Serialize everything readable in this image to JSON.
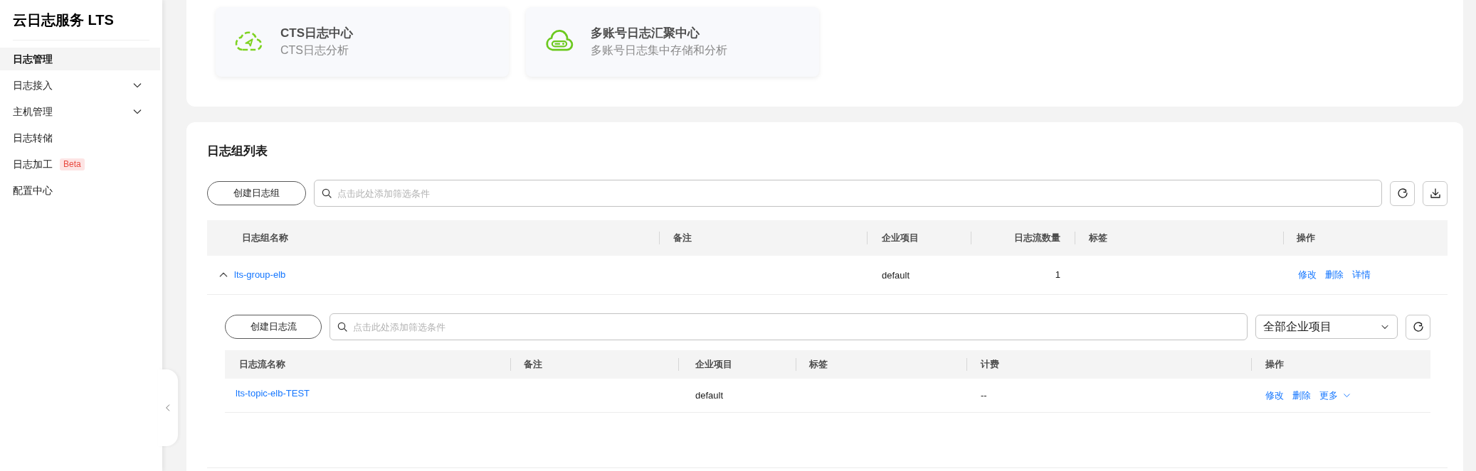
{
  "sidebar": {
    "title": "云日志服务 LTS",
    "items": [
      {
        "label": "日志管理",
        "selected": true,
        "kind": "link"
      },
      {
        "label": "日志接入",
        "selected": false,
        "kind": "group"
      },
      {
        "label": "主机管理",
        "selected": false,
        "kind": "group"
      },
      {
        "label": "日志转储",
        "selected": false,
        "kind": "link"
      },
      {
        "label": "日志加工",
        "selected": false,
        "kind": "link",
        "badge": "Beta"
      },
      {
        "label": "配置中心",
        "selected": false,
        "kind": "link"
      }
    ]
  },
  "cards": [
    {
      "title": "CTS日志中心",
      "subtitle": "CTS日志分析"
    },
    {
      "title": "多账号日志汇聚中心",
      "subtitle": "多账号日志集中存储和分析"
    }
  ],
  "log_groups": {
    "title": "日志组列表",
    "create_button": "创建日志组",
    "search": {
      "placeholder": "点击此处添加筛选条件"
    },
    "columns": [
      "日志组名称",
      "备注",
      "企业项目",
      "日志流数量",
      "标签",
      "操作"
    ],
    "rows": [
      {
        "expanded": true,
        "name": "lts-group-elb",
        "enterprise_project": "default",
        "stream_count": "1",
        "actions": [
          {
            "label": "修改",
            "kind": "link"
          },
          {
            "label": "删除",
            "kind": "link"
          },
          {
            "label": "详情",
            "kind": "link"
          }
        ],
        "streams": {
          "create_button": "创建日志流",
          "search": {
            "placeholder": "点击此处添加筛选条件"
          },
          "project_select": "全部企业项目",
          "columns": [
            "日志流名称",
            "备注",
            "企业项目",
            "标签",
            "计费",
            "操作"
          ],
          "rows": [
            {
              "name": "lts-topic-elb-TEST",
              "enterprise_project": "default",
              "billing": "--",
              "actions": [
                {
                  "label": "修改",
                  "kind": "link"
                },
                {
                  "label": "删除",
                  "kind": "link"
                },
                {
                  "label": "更多",
                  "kind": "menu"
                }
              ]
            }
          ]
        }
      }
    ]
  }
}
